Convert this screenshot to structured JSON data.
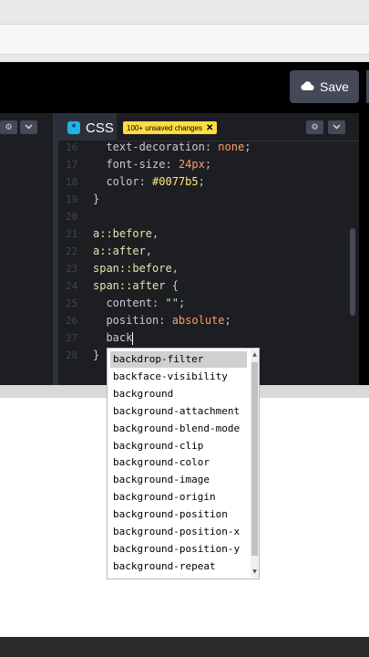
{
  "header": {
    "save_label": "Save",
    "save_icon": "cloud-icon"
  },
  "css_panel": {
    "tab_label": "CSS",
    "logo_glyph": "*",
    "unsaved_badge": "100+ unsaved changes",
    "unsaved_close": "✕"
  },
  "editor": {
    "lines": [
      {
        "num": "16",
        "parts": [
          {
            "cls": "prop",
            "t": "  text-decoration"
          },
          {
            "cls": "punc",
            "t": ": "
          },
          {
            "cls": "val",
            "t": "none"
          },
          {
            "cls": "punc",
            "t": ";"
          }
        ]
      },
      {
        "num": "17",
        "parts": [
          {
            "cls": "prop",
            "t": "  font-size"
          },
          {
            "cls": "punc",
            "t": ": "
          },
          {
            "cls": "val",
            "t": "24px"
          },
          {
            "cls": "punc",
            "t": ";"
          }
        ]
      },
      {
        "num": "18",
        "parts": [
          {
            "cls": "prop",
            "t": "  color"
          },
          {
            "cls": "punc",
            "t": ": "
          },
          {
            "cls": "hex",
            "t": "#0077b5"
          },
          {
            "cls": "punc",
            "t": ";"
          }
        ]
      },
      {
        "num": "19",
        "parts": [
          {
            "cls": "punc",
            "t": "}"
          }
        ]
      },
      {
        "num": "20",
        "parts": []
      },
      {
        "num": "21",
        "parts": [
          {
            "cls": "sel",
            "t": "a::before"
          },
          {
            "cls": "punc",
            "t": ","
          }
        ]
      },
      {
        "num": "22",
        "parts": [
          {
            "cls": "sel",
            "t": "a::after"
          },
          {
            "cls": "punc",
            "t": ","
          }
        ]
      },
      {
        "num": "23",
        "parts": [
          {
            "cls": "sel",
            "t": "span::before"
          },
          {
            "cls": "punc",
            "t": ","
          }
        ]
      },
      {
        "num": "24",
        "parts": [
          {
            "cls": "sel",
            "t": "span::after"
          },
          {
            "cls": "punc",
            "t": " {"
          }
        ]
      },
      {
        "num": "25",
        "parts": [
          {
            "cls": "prop",
            "t": "  content"
          },
          {
            "cls": "punc",
            "t": ": "
          },
          {
            "cls": "str",
            "t": "\"\""
          },
          {
            "cls": "punc",
            "t": ";"
          }
        ]
      },
      {
        "num": "26",
        "parts": [
          {
            "cls": "prop",
            "t": "  position"
          },
          {
            "cls": "punc",
            "t": ": "
          },
          {
            "cls": "val",
            "t": "absolute"
          },
          {
            "cls": "punc",
            "t": ";"
          }
        ]
      },
      {
        "num": "27",
        "parts": [
          {
            "cls": "prop",
            "t": "  back"
          }
        ],
        "cursor": true
      },
      {
        "num": "28",
        "parts": [
          {
            "cls": "punc",
            "t": "}"
          }
        ]
      }
    ]
  },
  "autocomplete": {
    "items": [
      "backdrop-filter",
      "backface-visibility",
      "background",
      "background-attachment",
      "background-blend-mode",
      "background-clip",
      "background-color",
      "background-image",
      "background-origin",
      "background-position",
      "background-position-x",
      "background-position-y",
      "background-repeat"
    ],
    "selected_index": 0
  },
  "colors": {
    "editor_bg": "#1d1e22",
    "accent_yellow": "#ffdd40",
    "css_blue": "#1fb3e6",
    "button_gray": "#444857"
  }
}
